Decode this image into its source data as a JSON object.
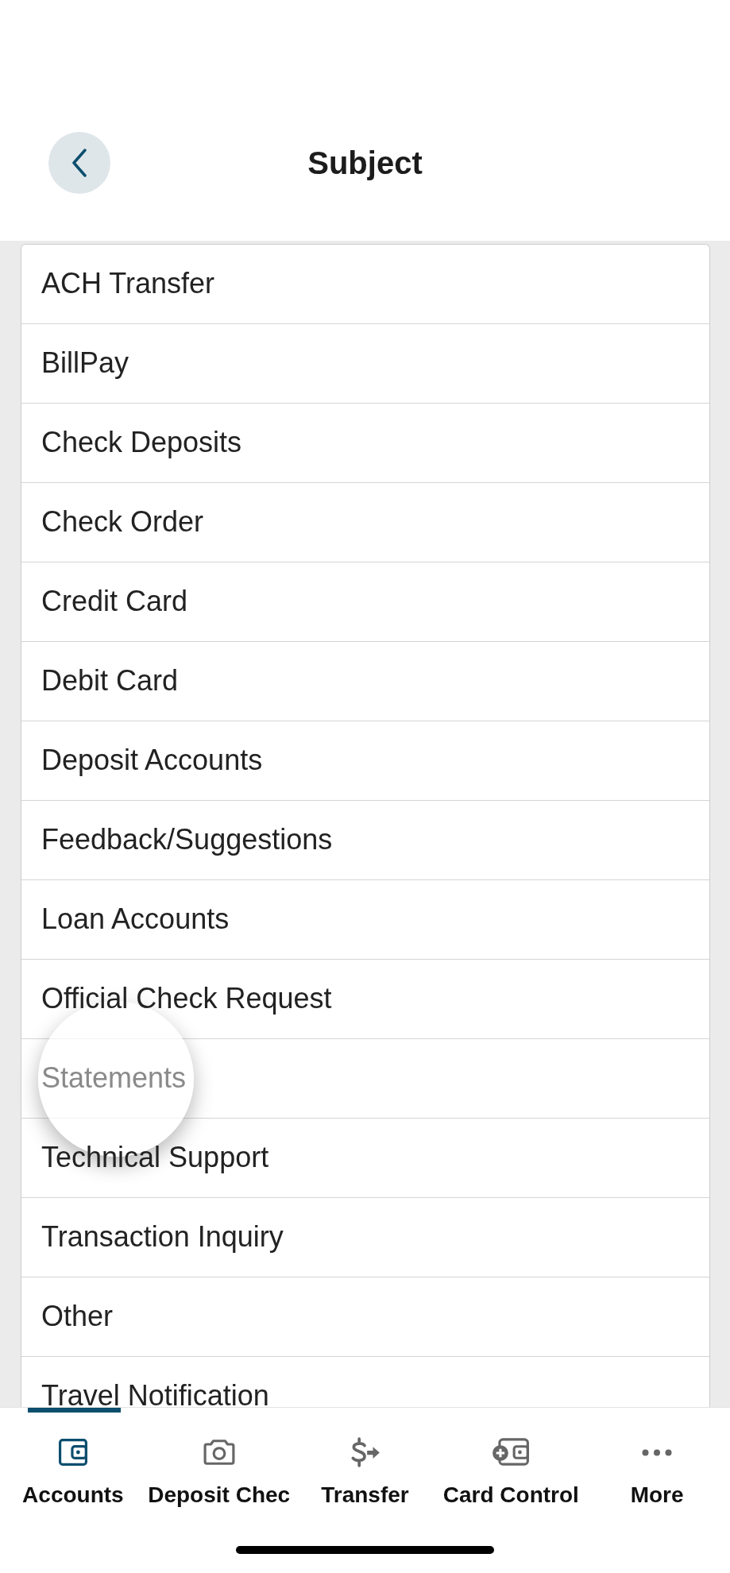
{
  "header": {
    "title": "Subject"
  },
  "subjects": [
    {
      "label": "ACH Transfer",
      "pressed": false
    },
    {
      "label": "BillPay",
      "pressed": false
    },
    {
      "label": "Check Deposits",
      "pressed": false
    },
    {
      "label": "Check Order",
      "pressed": false
    },
    {
      "label": "Credit Card",
      "pressed": false
    },
    {
      "label": "Debit Card",
      "pressed": false
    },
    {
      "label": "Deposit Accounts",
      "pressed": false
    },
    {
      "label": "Feedback/Suggestions",
      "pressed": false
    },
    {
      "label": "Loan Accounts",
      "pressed": false
    },
    {
      "label": "Official Check Request",
      "pressed": false
    },
    {
      "label": "Statements",
      "pressed": true
    },
    {
      "label": "Technical Support",
      "pressed": false
    },
    {
      "label": "Transaction Inquiry",
      "pressed": false
    },
    {
      "label": "Other",
      "pressed": false
    },
    {
      "label": "Travel Notification",
      "pressed": false
    }
  ],
  "tabs": [
    {
      "label": "Accounts",
      "selected": true
    },
    {
      "label": "Deposit Chec",
      "selected": false
    },
    {
      "label": "Transfer",
      "selected": false
    },
    {
      "label": "Card Control",
      "selected": false
    },
    {
      "label": "More",
      "selected": false
    }
  ]
}
